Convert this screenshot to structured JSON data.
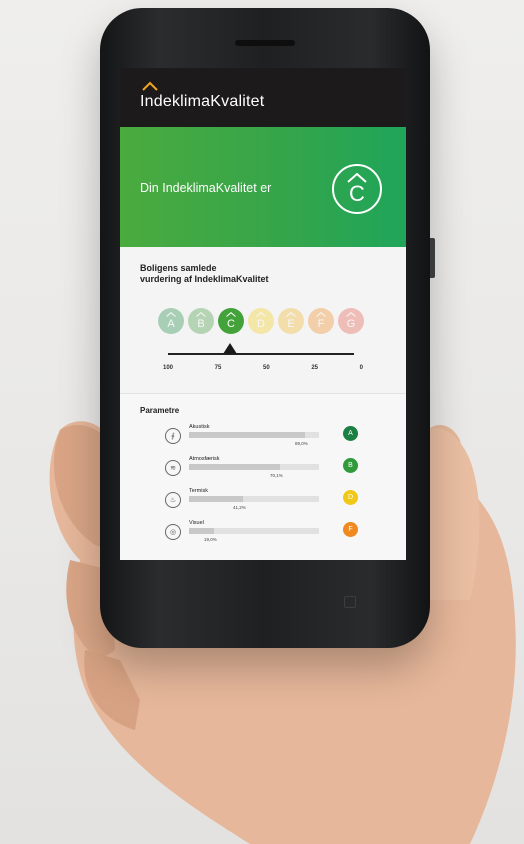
{
  "app": {
    "title": "IndeklimaKvalitet"
  },
  "hero": {
    "text": "Din IndeklimaKvalitet er",
    "grade": "C",
    "color": "#3aa648"
  },
  "rating": {
    "title_line1": "Boligens samlede",
    "title_line2": "vurdering af IndeklimaKvalitet",
    "grades": [
      {
        "letter": "A",
        "color": "#1f8a45",
        "active": false
      },
      {
        "letter": "B",
        "color": "#3f9a3c",
        "active": false
      },
      {
        "letter": "C",
        "color": "#43a33a",
        "active": true
      },
      {
        "letter": "D",
        "color": "#f2cf19",
        "active": false
      },
      {
        "letter": "E",
        "color": "#f3b327",
        "active": false
      },
      {
        "letter": "F",
        "color": "#f08b1f",
        "active": false
      },
      {
        "letter": "G",
        "color": "#e65a4b",
        "active": false
      }
    ],
    "ticks": [
      "100",
      "75",
      "50",
      "25",
      "0"
    ],
    "marker_value": 68
  },
  "params": {
    "title": "Parametre",
    "items": [
      {
        "label": "Akustisk",
        "value_text": "89,0%",
        "value": 89.0,
        "grade": "A",
        "grade_color": "#1c7f43",
        "icon": "ear-icon",
        "icon_glyph": "∮"
      },
      {
        "label": "Atmosfærisk",
        "value_text": "70,1%",
        "value": 70.1,
        "grade": "B",
        "grade_color": "#319a3b",
        "icon": "wind-icon",
        "icon_glyph": "≋"
      },
      {
        "label": "Termisk",
        "value_text": "41,2%",
        "value": 41.2,
        "grade": "D",
        "grade_color": "#f2c818",
        "icon": "thermometer-icon",
        "icon_glyph": "♨"
      },
      {
        "label": "Visuel",
        "value_text": "19,0%",
        "value": 19.0,
        "grade": "F",
        "grade_color": "#f08920",
        "icon": "eye-icon",
        "icon_glyph": "◎"
      }
    ]
  }
}
